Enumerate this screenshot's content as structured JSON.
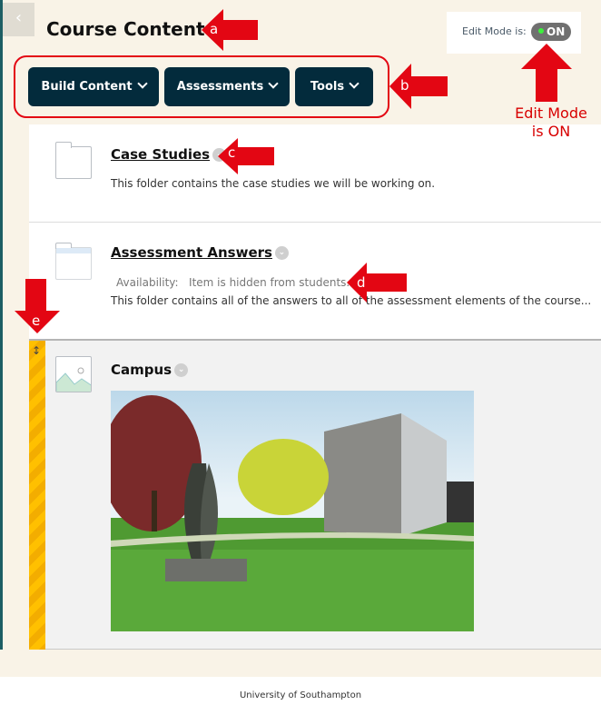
{
  "header": {
    "title": "Course Content",
    "collapse_icon": "chevron-left-icon"
  },
  "edit_mode": {
    "label": "Edit Mode is:",
    "state": "ON"
  },
  "toolbar": {
    "buttons": [
      "Build Content",
      "Assessments",
      "Tools"
    ]
  },
  "items": [
    {
      "title": "Case Studies",
      "description": "This folder contains the case studies we will be working on.",
      "icon": "folder-icon"
    },
    {
      "title": "Assessment Answers",
      "availability_label": "Availability:",
      "availability": "Item is hidden from students.",
      "description": "This folder contains all of the answers to all of the assessment elements of the course...",
      "icon": "folder-icon"
    },
    {
      "title": "Campus",
      "icon": "image-icon"
    }
  ],
  "annotations": {
    "a": "a",
    "b": "b",
    "c": "c",
    "d": "d",
    "e": "e",
    "note": "Edit Mode is ON",
    "color": "#e30613"
  },
  "footer": "University of Southampton"
}
